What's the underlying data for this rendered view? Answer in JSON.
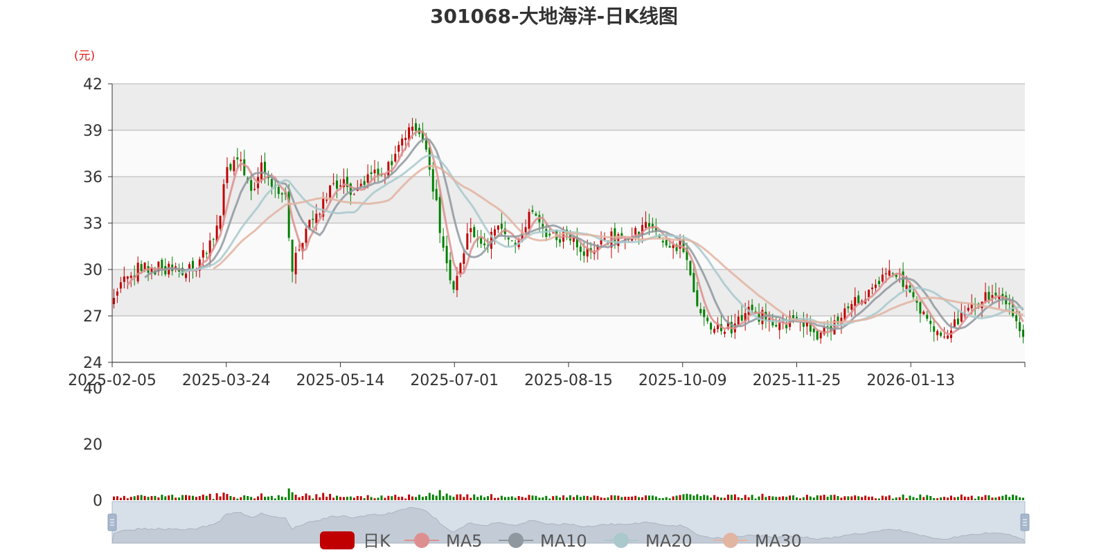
{
  "chart_data": {
    "type": "candlestick",
    "title": "301068-大地海洋-日K线图",
    "price_unit_label": "(元)",
    "price_axis": {
      "ylim": [
        24,
        42
      ],
      "ticks": [
        24,
        27,
        30,
        33,
        36,
        39,
        42
      ]
    },
    "volume_axis": {
      "ylim": [
        0,
        40
      ],
      "ticks": [
        0,
        20,
        40
      ]
    },
    "x_tick_labels": [
      "2025-02-05",
      "2025-03-24",
      "2025-05-14",
      "2025-07-01",
      "2025-08-15",
      "2025-10-09",
      "2025-11-25",
      "2026-01-13"
    ],
    "candle_count": 231,
    "up_color": "#c00000",
    "down_color": "#008000",
    "close_anchors": [
      [
        0,
        28.6
      ],
      [
        8,
        30.2
      ],
      [
        15,
        30.0
      ],
      [
        20,
        29.8
      ],
      [
        25,
        30.4
      ],
      [
        30,
        32.4
      ],
      [
        33,
        36.5
      ],
      [
        36,
        37.4
      ],
      [
        40,
        34.8
      ],
      [
        43,
        36.8
      ],
      [
        46,
        35.5
      ],
      [
        50,
        34.6
      ],
      [
        52,
        30.0
      ],
      [
        55,
        32.0
      ],
      [
        58,
        33.2
      ],
      [
        62,
        34.8
      ],
      [
        66,
        35.7
      ],
      [
        70,
        34.9
      ],
      [
        74,
        35.9
      ],
      [
        78,
        36.3
      ],
      [
        82,
        37.4
      ],
      [
        85,
        38.6
      ],
      [
        88,
        39.2
      ],
      [
        90,
        38.7
      ],
      [
        93,
        35.4
      ],
      [
        97,
        30.2
      ],
      [
        99,
        28.8
      ],
      [
        100,
        29.8
      ],
      [
        104,
        32.8
      ],
      [
        108,
        31.7
      ],
      [
        112,
        32.5
      ],
      [
        116,
        31.6
      ],
      [
        119,
        32.7
      ],
      [
        123,
        33.9
      ],
      [
        127,
        32.0
      ],
      [
        132,
        32.1
      ],
      [
        136,
        31.3
      ],
      [
        140,
        31.2
      ],
      [
        145,
        32.1
      ],
      [
        150,
        31.9
      ],
      [
        155,
        33.0
      ],
      [
        160,
        31.8
      ],
      [
        166,
        31.4
      ],
      [
        170,
        27.8
      ],
      [
        174,
        26.4
      ],
      [
        180,
        26.2
      ],
      [
        185,
        27.2
      ],
      [
        190,
        26.9
      ],
      [
        195,
        26.5
      ],
      [
        200,
        26.9
      ],
      [
        205,
        25.6
      ],
      [
        210,
        26.5
      ],
      [
        215,
        28.1
      ],
      [
        219,
        28.3
      ],
      [
        223,
        29.1
      ],
      [
        226,
        30.1
      ],
      [
        229,
        29.5
      ],
      [
        232,
        28.6
      ],
      [
        236,
        27.0
      ],
      [
        239,
        25.7
      ],
      [
        243,
        26.1
      ],
      [
        246,
        26.6
      ],
      [
        250,
        27.5
      ],
      [
        254,
        28.3
      ],
      [
        258,
        28.1
      ],
      [
        261,
        27.3
      ],
      [
        263,
        26.4
      ],
      [
        265,
        25.8
      ]
    ],
    "series": [
      {
        "name": "日K",
        "color": "#c00000"
      },
      {
        "name": "MA5",
        "window": 5,
        "color": "#dd8f8f"
      },
      {
        "name": "MA10",
        "window": 10,
        "color": "#8f989f"
      },
      {
        "name": "MA20",
        "window": 20,
        "color": "#a9c9cc"
      },
      {
        "name": "MA30",
        "window": 30,
        "color": "#e2b4a2"
      }
    ],
    "legend_position": "bottom-center",
    "grid": true,
    "datazoom_slider": true
  }
}
